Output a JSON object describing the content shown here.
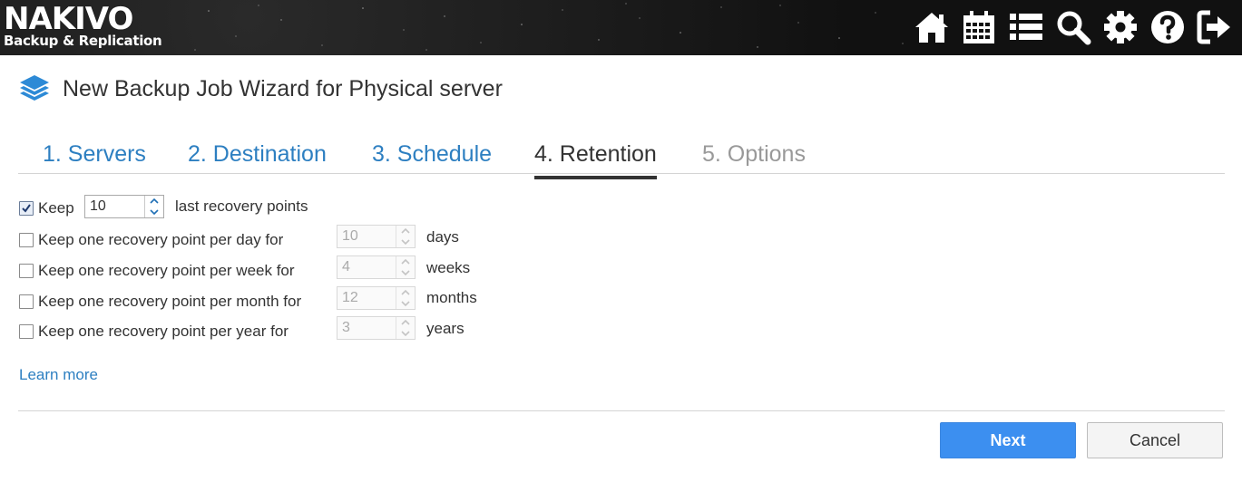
{
  "header": {
    "logo_main": "NAKIVO",
    "logo_sub": "Backup & Replication",
    "nav_icons": [
      "home-icon",
      "calendar-icon",
      "list-icon",
      "search-icon",
      "gear-icon",
      "help-icon",
      "logout-icon"
    ]
  },
  "page": {
    "title": "New Backup Job Wizard for Physical server"
  },
  "tabs": [
    {
      "label": "1. Servers",
      "state": "link"
    },
    {
      "label": "2. Destination",
      "state": "link"
    },
    {
      "label": "3. Schedule",
      "state": "link"
    },
    {
      "label": "4. Retention",
      "state": "active"
    },
    {
      "label": "5. Options",
      "state": "disabled"
    }
  ],
  "retention": {
    "keep_last": {
      "label": "Keep",
      "value": "10",
      "suffix": "last recovery points",
      "checked": true
    },
    "rows": [
      {
        "label": "Keep one recovery point per day for",
        "value": "10",
        "unit": "days",
        "checked": false
      },
      {
        "label": "Keep one recovery point per week for",
        "value": "4",
        "unit": "weeks",
        "checked": false
      },
      {
        "label": "Keep one recovery point per month for",
        "value": "12",
        "unit": "months",
        "checked": false
      },
      {
        "label": "Keep one recovery point per year for",
        "value": "3",
        "unit": "years",
        "checked": false
      }
    ]
  },
  "learn_more": "Learn more",
  "footer": {
    "next_label": "Next",
    "cancel_label": "Cancel"
  },
  "colors": {
    "link": "#2d7fc1",
    "primary_button": "#3c8ff0",
    "header_bg": "#121212"
  }
}
